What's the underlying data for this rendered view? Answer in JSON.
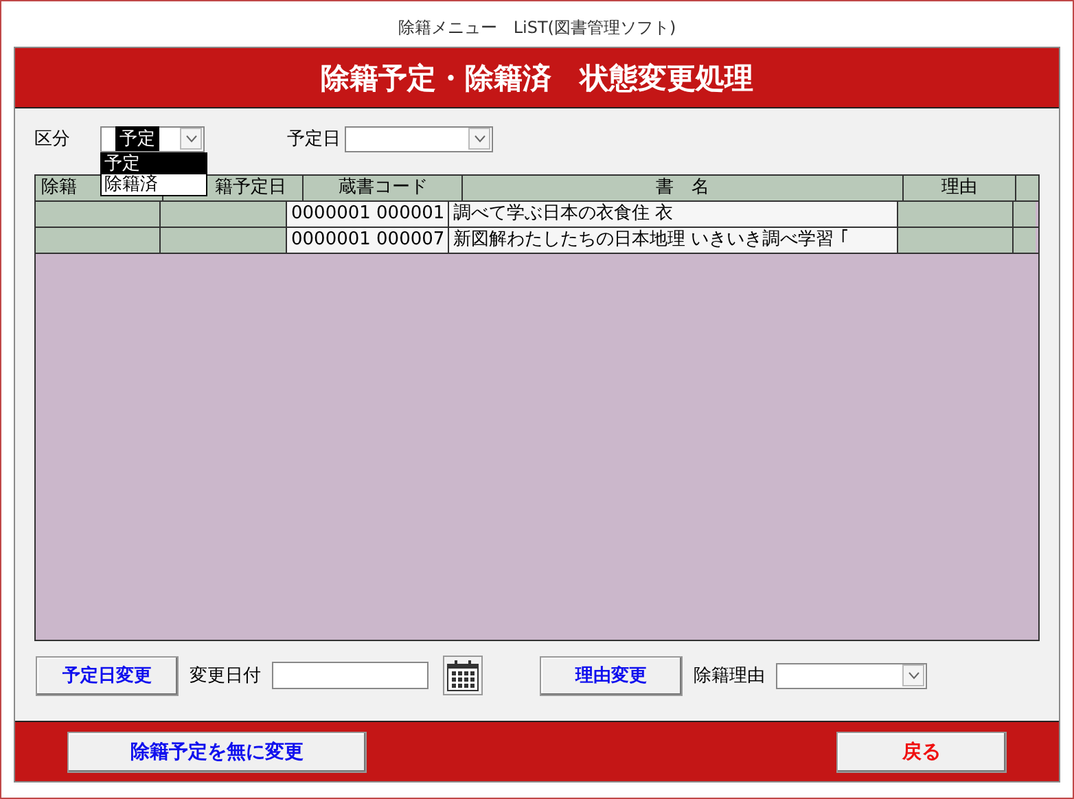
{
  "window": {
    "title": "除籍メニュー　LiST(図書管理ソフト)"
  },
  "header": {
    "title": "除籍予定・除籍済　状態変更処理"
  },
  "filters": {
    "category": {
      "label": "区分",
      "value": "予定",
      "expanded": true,
      "options": [
        {
          "label": "予定",
          "selected": true
        },
        {
          "label": "除籍済",
          "selected": false
        }
      ]
    },
    "date": {
      "label": "予定日"
    }
  },
  "table": {
    "columns": [
      "除籍",
      "籍予定日",
      "蔵書コード",
      "書　名",
      "理由"
    ],
    "rows": [
      [
        "",
        "",
        "0000001 000001",
        "調べて学ぶ日本の衣食住  衣",
        ""
      ],
      [
        "",
        "",
        "0000001 000007",
        "新図解わたしたちの日本地理 いきいき調べ学習  ｢",
        ""
      ]
    ]
  },
  "actions": {
    "date_button": "予定日変更",
    "date_label": "変更日付",
    "reason_button": "理由変更",
    "reason_label": "除籍理由"
  },
  "footer": {
    "cancel_button": "除籍予定を無に変更",
    "back_button": "戻る"
  }
}
